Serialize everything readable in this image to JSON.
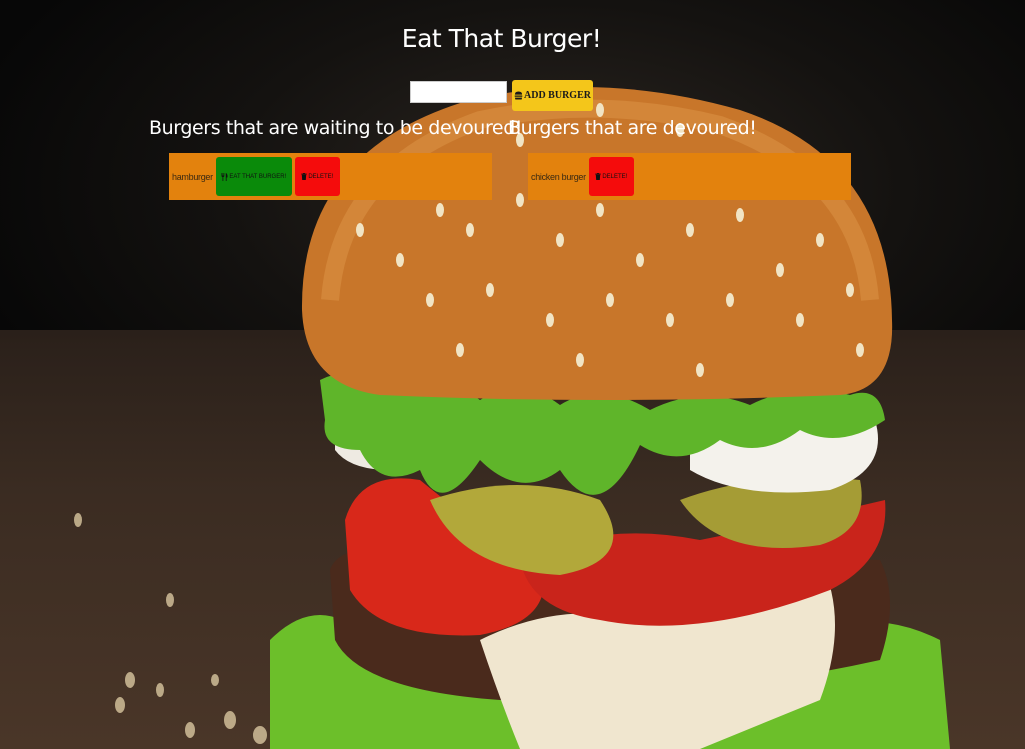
{
  "page": {
    "title": "Eat That Burger!"
  },
  "form": {
    "input_value": "",
    "add_button_label": "ADD BURGER",
    "add_icon": "burger-icon"
  },
  "waiting": {
    "heading": "Burgers that are waiting to be devoured!",
    "items": [
      {
        "name": "hamburger",
        "eat_label": "EAT THAT BURGER!",
        "eat_icon": "utensils-icon",
        "delete_label": "DELETE!",
        "delete_icon": "trash-icon"
      }
    ]
  },
  "devoured": {
    "heading": "Burgers that are devoured!",
    "items": [
      {
        "name": "chicken burger",
        "delete_label": "DELETE!",
        "delete_icon": "trash-icon"
      }
    ]
  },
  "colors": {
    "row_bg": "#e3820d",
    "add_button": "#f4c61a",
    "eat_button": "#0a8a0a",
    "delete_button": "#f50c0c",
    "title_text": "#ffffff"
  }
}
